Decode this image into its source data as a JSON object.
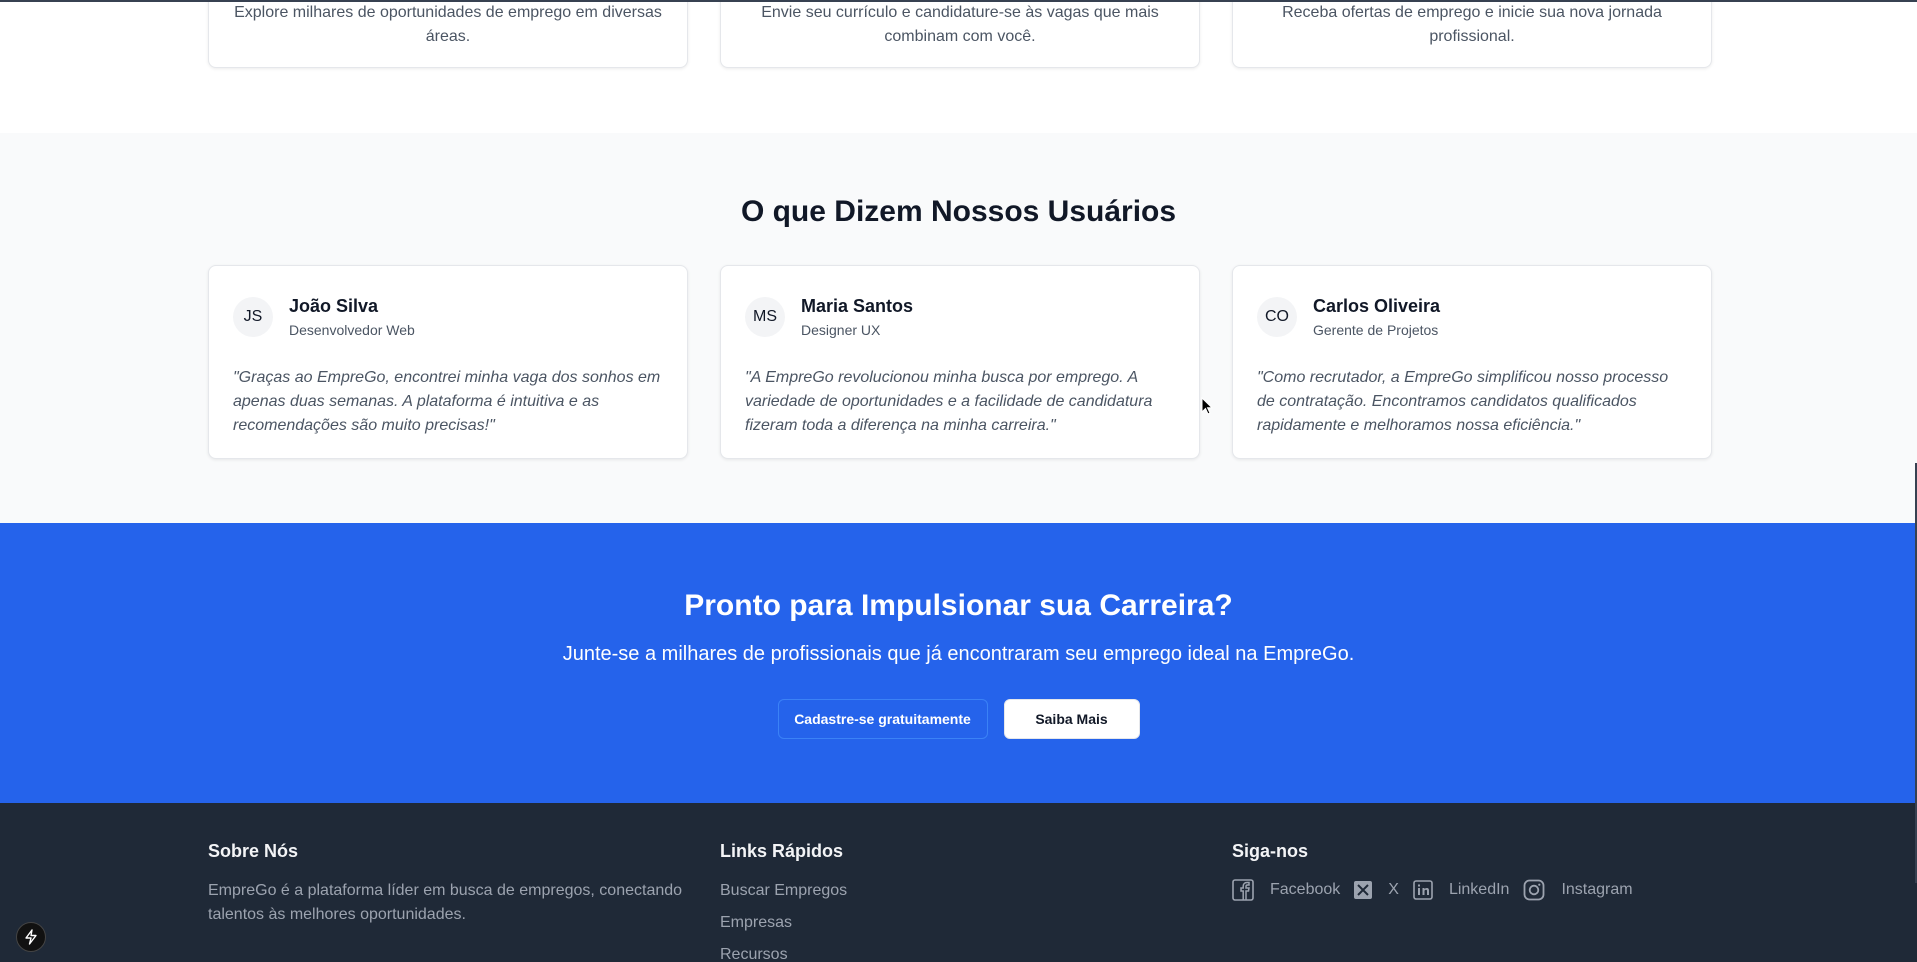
{
  "features": [
    {
      "text": "Explore milhares de oportunidades de emprego em diversas áreas."
    },
    {
      "text": "Envie seu currículo e candidature-se às vagas que mais combinam com você."
    },
    {
      "text": "Receba ofertas de emprego e inicie sua nova jornada profissional."
    }
  ],
  "testimonials": {
    "title": "O que Dizem Nossos Usuários",
    "items": [
      {
        "initials": "JS",
        "name": "João Silva",
        "role": "Desenvolvedor Web",
        "quote": "\"Graças ao EmpreGo, encontrei minha vaga dos sonhos em apenas duas semanas. A plataforma é intuitiva e as recomendações são muito precisas!\""
      },
      {
        "initials": "MS",
        "name": "Maria Santos",
        "role": "Designer UX",
        "quote": "\"A EmpreGo revolucionou minha busca por emprego. A variedade de oportunidades e a facilidade de candidatura fizeram toda a diferença na minha carreira.\""
      },
      {
        "initials": "CO",
        "name": "Carlos Oliveira",
        "role": "Gerente de Projetos",
        "quote": "\"Como recrutador, a EmpreGo simplificou nosso processo de contratação. Encontramos candidatos qualificados rapidamente e melhoramos nossa eficiência.\""
      }
    ]
  },
  "cta": {
    "title": "Pronto para Impulsionar sua Carreira?",
    "subtitle": "Junte-se a milhares de profissionais que já encontraram seu emprego ideal na EmpreGo.",
    "primary_label": "Cadastre-se gratuitamente",
    "secondary_label": "Saiba Mais"
  },
  "footer": {
    "about": {
      "title": "Sobre Nós",
      "text": "EmpreGo é a plataforma líder em busca de empregos, conectando talentos às melhores oportunidades."
    },
    "links": {
      "title": "Links Rápidos",
      "items": [
        "Buscar Empregos",
        "Empresas",
        "Recursos"
      ]
    },
    "social": {
      "title": "Siga-nos",
      "items": [
        {
          "label": "Facebook",
          "icon": "facebook-icon"
        },
        {
          "label": "X",
          "icon": "x-icon"
        },
        {
          "label": "LinkedIn",
          "icon": "linkedin-icon"
        },
        {
          "label": "Instagram",
          "icon": "instagram-icon"
        }
      ]
    }
  },
  "colors": {
    "brand_blue": "#2563eb",
    "footer_bg": "#1f2937",
    "section_bg": "#f9fafb"
  }
}
